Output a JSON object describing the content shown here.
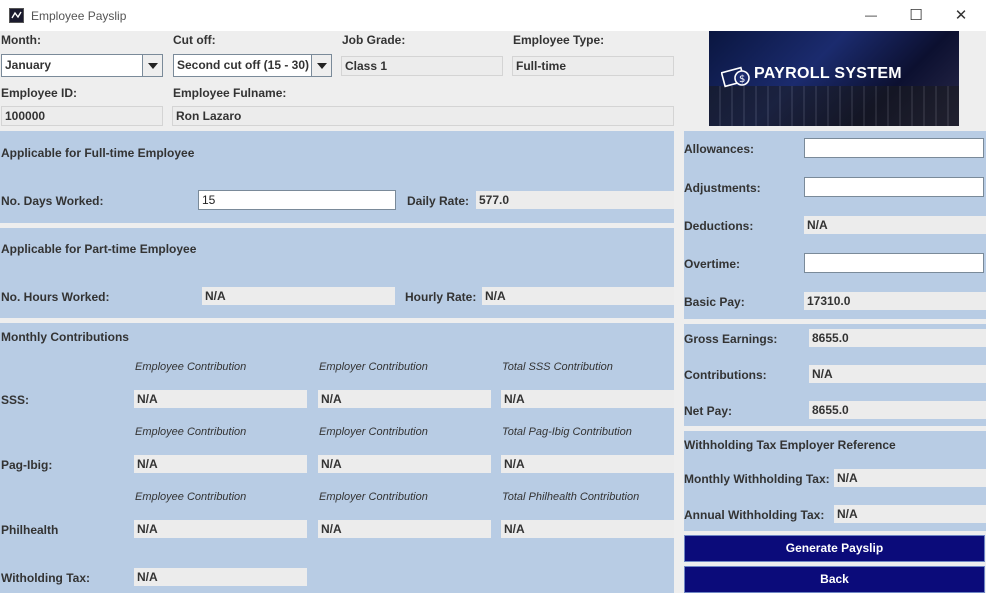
{
  "window": {
    "title": "Employee Payslip",
    "minimize_glyph": "—",
    "maximize_glyph": "☐",
    "close_glyph": "✕"
  },
  "header": {
    "month_label": "Month:",
    "month_value": "January",
    "cutoff_label": "Cut off:",
    "cutoff_value": "Second cut off (15 - 30)",
    "job_grade_label": "Job Grade:",
    "job_grade_value": "Class 1",
    "employee_type_label": "Employee Type:",
    "employee_type_value": "Full-time",
    "employee_id_label": "Employee ID:",
    "employee_id_value": "100000",
    "fullname_label": "Employee Fulname:",
    "fullname_value": "Ron Lazaro",
    "banner_text": "PAYROLL SYSTEM"
  },
  "fulltime": {
    "heading": "Applicable for Full-time Employee",
    "days_label": "No. Days Worked:",
    "days_value": "15",
    "rate_label": "Daily Rate:",
    "rate_value": "577.0"
  },
  "parttime": {
    "heading": "Applicable for Part-time Employee",
    "hours_label": "No. Hours Worked:",
    "hours_value": "N/A",
    "rate_label": "Hourly Rate:",
    "rate_value": "N/A"
  },
  "contributions": {
    "heading": "Monthly Contributions",
    "employee_col": "Employee Contribution",
    "employer_col": "Employer Contribution",
    "sss": {
      "label": "SSS:",
      "total_col": "Total SSS Contribution",
      "employee": "N/A",
      "employer": "N/A",
      "total": "N/A"
    },
    "pagibig": {
      "label": "Pag-Ibig:",
      "total_col": "Total Pag-Ibig Contribution",
      "employee": "N/A",
      "employer": "N/A",
      "total": "N/A"
    },
    "philhealth": {
      "label": "Philhealth",
      "total_col": "Total Philhealth Contribution",
      "employee": "N/A",
      "employer": "N/A",
      "total": "N/A"
    },
    "withholding_label": "Witholding Tax:",
    "withholding_value": "N/A"
  },
  "right": {
    "allowances_label": "Allowances:",
    "allowances_value": "",
    "adjustments_label": "Adjustments:",
    "adjustments_value": "",
    "deductions_label": "Deductions:",
    "deductions_value": "N/A",
    "overtime_label": "Overtime:",
    "overtime_value": "",
    "basic_pay_label": "Basic Pay:",
    "basic_pay_value": "17310.0",
    "gross_label": "Gross Earnings:",
    "gross_value": "8655.0",
    "contrib_label": "Contributions:",
    "contrib_value": "N/A",
    "net_label": "Net Pay:",
    "net_value": "8655.0",
    "tax_heading": "Withholding Tax Employer Reference",
    "monthly_tax_label": "Monthly Withholding Tax:",
    "monthly_tax_value": "N/A",
    "annual_tax_label": "Annual Withholding Tax:",
    "annual_tax_value": "N/A",
    "generate_button": "Generate Payslip",
    "back_button": "Back"
  },
  "colors": {
    "panel": "#b8cce4",
    "button": "#0b0b7a",
    "field": "#ececec"
  },
  "icons": [
    "app-icon",
    "payroll-envelope-icon",
    "combo-arrow-icon"
  ]
}
